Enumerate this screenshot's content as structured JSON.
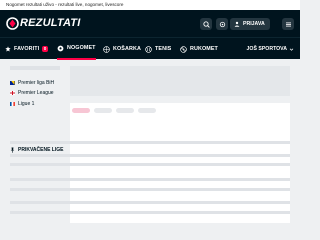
{
  "page": {
    "title": "Nogomet rezultati uživo - rezultati live, nogomet, livescore"
  },
  "header": {
    "logo_text": "REZULTATI",
    "search_icon": "search-icon",
    "user_icon": "user-icon",
    "login_label": "PRIJAVA",
    "menu_icon": "menu-icon"
  },
  "nav": {
    "items": [
      {
        "label": "FAVORITI",
        "icon": "star-icon",
        "badge": "0"
      },
      {
        "label": "NOGOMET",
        "icon": "soccer-ball-icon"
      },
      {
        "label": "KOŠARKA",
        "icon": "basketball-icon"
      },
      {
        "label": "TENIS",
        "icon": "tennis-icon"
      },
      {
        "label": "RUKOMET",
        "icon": "handball-icon"
      }
    ],
    "more_label": "JOŠ SPORTOVA"
  },
  "sidebar": {
    "pinned_title": "PRIKVAČENE LIGE",
    "leagues": [
      {
        "label": "Premier liga BiH",
        "flag_colors": [
          "#002395",
          "#fecb00"
        ]
      },
      {
        "label": "Premier League",
        "flag_colors": [
          "#ffffff",
          "#ce1124"
        ]
      },
      {
        "label": "Ligue 1",
        "flag_colors": [
          "#0055a4",
          "#ffffff",
          "#ef4135"
        ]
      }
    ]
  },
  "colors": {
    "header_bg": "#00141e",
    "accent": "#ff0046",
    "skeleton": "#dfe2e6"
  }
}
